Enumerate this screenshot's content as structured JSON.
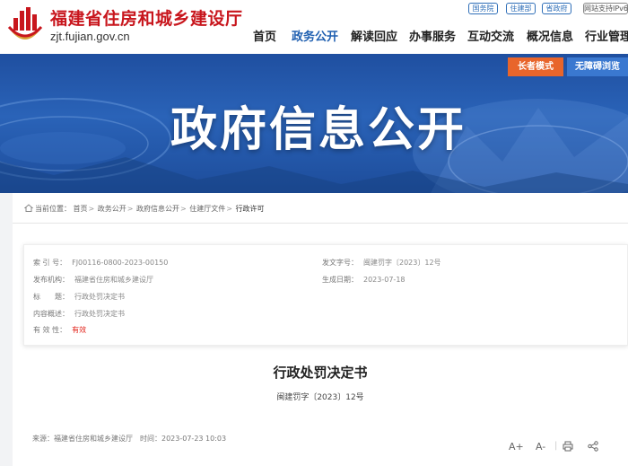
{
  "header": {
    "site_name": "福建省住房和城乡建设厅",
    "site_url": "zjt.fujian.gov.cn",
    "top_links": [
      "国务院",
      "住建部",
      "省政府",
      "网站支持IPv6"
    ],
    "nav": [
      "首页",
      "政务公开",
      "解读回应",
      "办事服务",
      "互动交流",
      "概况信息",
      "行业管理"
    ],
    "active_nav": "政务公开"
  },
  "banner": {
    "title": "政府信息公开",
    "elder_mode": "长者模式",
    "accessible_browse": "无障碍浏览"
  },
  "breadcrumb": {
    "prefix": "当前位置：",
    "items": [
      "首页",
      "政务公开",
      "政府信息公开",
      "住建厅文件",
      "行政许可"
    ]
  },
  "meta": {
    "index_label": "索 引 号：",
    "index_value": "FJ00116-0800-2023-00150",
    "doc_no_label": "发文字号：",
    "doc_no_value": "闽建罚字〔2023〕12号",
    "publisher_label": "发布机构：",
    "publisher_value": "福建省住房和城乡建设厅",
    "date_label": "生成日期：",
    "date_value": "2023-07-18",
    "title_label": "标　　题：",
    "title_value": "行政处罚决定书",
    "summary_label": "内容概述：",
    "summary_value": "行政处罚决定书",
    "validity_label": "有 效 性：",
    "validity_value": "有效"
  },
  "document": {
    "title": "行政处罚决定书",
    "number": "闽建罚字〔2023〕12号"
  },
  "footer": {
    "source_label": "来源：",
    "source_value": "福建省住房和城乡建设厅",
    "time_label": "时间：",
    "time_value": "2023-07-23 10:03",
    "font_increase": "A+",
    "font_decrease": "A-"
  },
  "colors": {
    "brand_red": "#c8161d",
    "nav_active_blue": "#1f5fb0",
    "elder_orange": "#e8652b",
    "access_blue": "#3a78d0",
    "valid_red": "#e2231a"
  },
  "icons": [
    "emblem-logo-icon",
    "home-icon",
    "print-icon",
    "share-icon"
  ]
}
